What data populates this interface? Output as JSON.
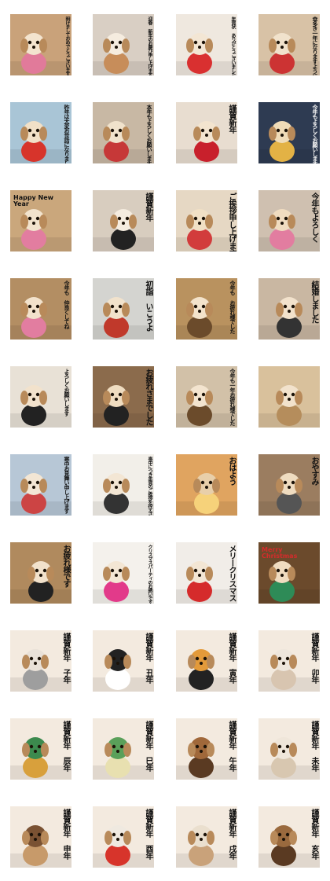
{
  "tiles": [
    {
      "caption": "明けましておめでとうございます",
      "bg": "#c9a27a",
      "fg": "#f3e4cf",
      "accent": "#e17a9a"
    },
    {
      "caption": "迎春 新年のお慶び申し上げます",
      "bg": "#d9cfc4",
      "fg": "#f5ecdf",
      "accent": "#c78d5a"
    },
    {
      "caption": "年賀状 ありがとうございました",
      "bg": "#efe8df",
      "fg": "#f3e6d4",
      "accent": "#d93030"
    },
    {
      "caption": "幸多き一年になりますように",
      "bg": "#d8c2a6",
      "fg": "#f1e2cc",
      "accent": "#c33"
    },
    {
      "caption": "昨年は大変お世話になりました",
      "bg": "#a9c5d6",
      "fg": "#f1e0c7",
      "accent": "#d7342b"
    },
    {
      "caption": "本年もよろしくお願いします",
      "bg": "#c8b8a4",
      "fg": "#f0e2cc",
      "accent": "#c63838"
    },
    {
      "caption": "謹賀新年",
      "bg": "#e8ddd0",
      "fg": "#f3e4cf",
      "accent": "#c8202c"
    },
    {
      "caption": "今年もよろしくお願いします",
      "bg": "#2e3b52",
      "fg": "#f0dcb8",
      "accent": "#e3b245"
    },
    {
      "caption": "Happy New Year",
      "bg": "#caa77c",
      "fg": "#f2e3cd",
      "accent": "#e27da0"
    },
    {
      "caption": "謹賀新年",
      "bg": "#d8cdbf",
      "fg": "#f5ecdf",
      "accent": "#222"
    },
    {
      "caption": "ご挨拶申し上げます",
      "bg": "#e6d8c4",
      "fg": "#f1e0c5",
      "accent": "#d23c3c"
    },
    {
      "caption": "今年もよろしく",
      "bg": "#cfc0b0",
      "fg": "#f0dcc0",
      "accent": "#e27da0"
    },
    {
      "caption": "今年も 仲良くしてね",
      "bg": "#b38e63",
      "fg": "#f2e2cc",
      "accent": "#e27da0"
    },
    {
      "caption": "初詣 いこうよ",
      "bg": "#d4d4d0",
      "fg": "#f1e2cc",
      "accent": "#c0392b"
    },
    {
      "caption": "今年も お疲れ様でした",
      "bg": "#b9925f",
      "fg": "#f3e3cb",
      "accent": "#6b4b2b"
    },
    {
      "caption": "結婚しました",
      "bg": "#c9b7a2",
      "fg": "#f2e2cc",
      "accent": "#333"
    },
    {
      "caption": "よろしくお願いします",
      "bg": "#e8e1d6",
      "fg": "#f2e2cc",
      "accent": "#222"
    },
    {
      "caption": "お疲れさまでした",
      "bg": "#8b6b4c",
      "fg": "#efdcc0",
      "accent": "#222"
    },
    {
      "caption": "今年も一年お疲れ様でした",
      "bg": "#d2c1a8",
      "fg": "#f3e4cf",
      "accent": "#6b4b2b"
    },
    {
      "caption": "",
      "bg": "#d9c19c",
      "fg": "#f2e2cc",
      "accent": "#b58d5c"
    },
    {
      "caption": "寒中お見舞い申し上げます",
      "bg": "#b7c7d6",
      "fg": "#f3e6d4",
      "accent": "#c44"
    },
    {
      "caption": "喪中につき年賀のご挨拶を控えさせていただきます",
      "bg": "#f2efe9",
      "fg": "#f3e6d4",
      "accent": "#333"
    },
    {
      "caption": "おはよう",
      "bg": "#e0a460",
      "fg": "#e8cfaa",
      "accent": "#f6d27a"
    },
    {
      "caption": "おやすみ",
      "bg": "#9b7d60",
      "fg": "#efdcc0",
      "accent": "#555"
    },
    {
      "caption": "お疲れ様です",
      "bg": "#b08a5e",
      "fg": "#f2e2cc",
      "accent": "#222"
    },
    {
      "caption": "クリスマスパーティのお誘いです",
      "bg": "#f4f1ec",
      "fg": "#f3e6d4",
      "accent": "#e23a8a"
    },
    {
      "caption": "メリークリスマス",
      "bg": "#f1ede8",
      "fg": "#f3e6d4",
      "accent": "#d52b2b"
    },
    {
      "caption": "Merry Christmas",
      "bg": "#6b4a2c",
      "fg": "#f0dcc0",
      "accent": "#2e8b57"
    },
    {
      "caption": "謹賀新年 子年",
      "bg": "#f3eadf",
      "fg": "#e9e1d8",
      "accent": "#9e9e9e"
    },
    {
      "caption": "謹賀新年 丑年",
      "bg": "#f3eadf",
      "fg": "#222",
      "accent": "#ffffff"
    },
    {
      "caption": "謹賀新年 寅年",
      "bg": "#f3eadf",
      "fg": "#e39a3a",
      "accent": "#222"
    },
    {
      "caption": "謹賀新年 卯年",
      "bg": "#f3eadf",
      "fg": "#eee6dc",
      "accent": "#d8c5b0"
    },
    {
      "caption": "謹賀新年 辰年",
      "bg": "#f3eadf",
      "fg": "#3c8a4e",
      "accent": "#d8a03c"
    },
    {
      "caption": "謹賀新年 巳年",
      "bg": "#f3eadf",
      "fg": "#5aa05a",
      "accent": "#e8e0b0"
    },
    {
      "caption": "謹賀新年 午年",
      "bg": "#f3eadf",
      "fg": "#a0683a",
      "accent": "#5a3a22"
    },
    {
      "caption": "謹賀新年 未年",
      "bg": "#f3eadf",
      "fg": "#efe6da",
      "accent": "#d8c7b0"
    },
    {
      "caption": "謹賀新年 申年",
      "bg": "#f3eadf",
      "fg": "#7a5233",
      "accent": "#c79a6a"
    },
    {
      "caption": "謹賀新年 酉年",
      "bg": "#f3eadf",
      "fg": "#efe9e0",
      "accent": "#d7342b"
    },
    {
      "caption": "謹賀新年 戌年",
      "bg": "#f3eadf",
      "fg": "#eadfce",
      "accent": "#c9a27a"
    },
    {
      "caption": "謹賀新年 亥年",
      "bg": "#f3eadf",
      "fg": "#9a6a3e",
      "accent": "#5a3a22"
    }
  ]
}
